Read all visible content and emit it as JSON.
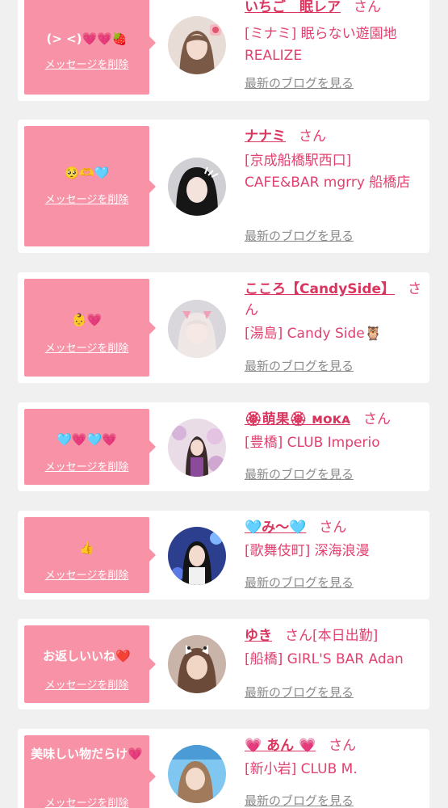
{
  "messages": [
    {
      "message": "(> <)💗💗🍓",
      "delete_label": "メッセージを削除",
      "name": "いちご　眠レア",
      "honorific": "さん",
      "shop": "[ミナミ] 眠らない遊園地 REALIZE",
      "blog_label": "最新のブログを見る"
    },
    {
      "message": "🥺🫶🩵",
      "delete_label": "メッセージを削除",
      "name": "ナナミ",
      "honorific": "さん",
      "shop": "[京成船橋駅西口] CAFE&BAR mgrry 船橋店",
      "blog_label": "最新のブログを見る"
    },
    {
      "message": "👶💗",
      "delete_label": "メッセージを削除",
      "name": "こころ【CandySide】",
      "honorific": "さん",
      "shop": "[湯島] Candy Side🦉",
      "blog_label": "最新のブログを見る"
    },
    {
      "message": "🩵💗🩵💗",
      "delete_label": "メッセージを削除",
      "name": "🏵萌果🏵 ᴍᴏᴋᴀ",
      "honorific": "さん",
      "shop": "[豊橋] CLUB Imperio",
      "blog_label": "最新のブログを見る"
    },
    {
      "message": "👍",
      "delete_label": "メッセージを削除",
      "name": "🩵み〜🩵",
      "honorific": "さん",
      "shop": "[歌舞伎町] 深海浪漫",
      "blog_label": "最新のブログを見る"
    },
    {
      "message": "お返しいいね❤️",
      "delete_label": "メッセージを削除",
      "name": "ゆき",
      "honorific": "さん[本日出勤]",
      "shop": "[船橋] GIRL'S BAR Adan",
      "blog_label": "最新のブログを見る"
    },
    {
      "message": "美味しい物だらけ💗",
      "delete_label": "メッセージを削除",
      "name": "💗 あん 💗",
      "honorific": "さん",
      "shop": "[新小岩] CLUB M.",
      "blog_label": "最新のブログを見る"
    }
  ],
  "colors": {
    "bubble": "#f892a6",
    "name": "#d9365f",
    "text": "#e2406f",
    "link": "#8a8a8a",
    "background": "#f0f0f0"
  }
}
